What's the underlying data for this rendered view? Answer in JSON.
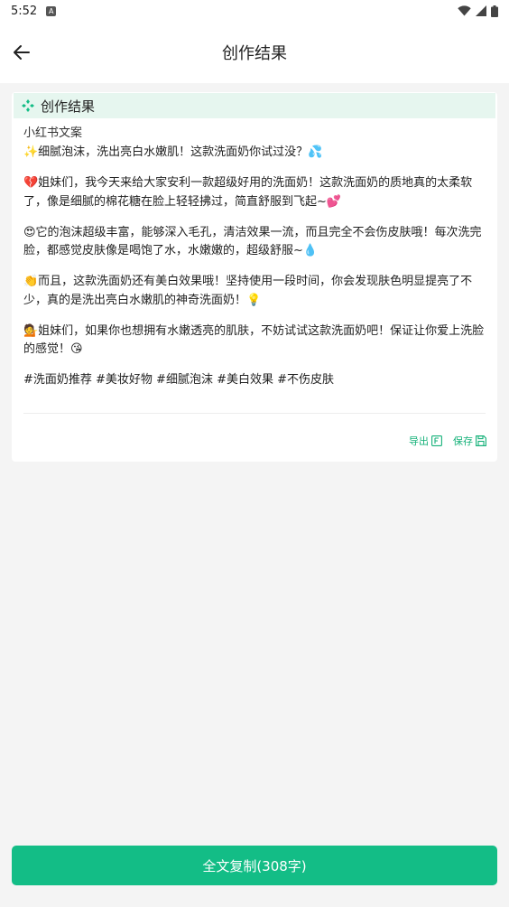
{
  "status_bar": {
    "time": "5:52",
    "notification_icon": "app-notification-icon",
    "icons": [
      "wifi-icon",
      "signal-icon",
      "battery-icon"
    ]
  },
  "app_bar": {
    "title": "创作结果",
    "back_icon": "back-arrow-icon"
  },
  "card": {
    "header_title": "创作结果",
    "header_icon": "sparkle-diamond-icon",
    "subtitle": "小红书文案",
    "paragraphs": [
      "✨细腻泡沫，洗出亮白水嫩肌！这款洗面奶你试过没？💦",
      "💔姐妹们，我今天来给大家安利一款超级好用的洗面奶！这款洗面奶的质地真的太柔软了，像是细腻的棉花糖在脸上轻轻拂过，简直舒服到飞起~💕",
      "😍它的泡沫超级丰富，能够深入毛孔，清洁效果一流，而且完全不会伤皮肤哦！每次洗完脸，都感觉皮肤像是喝饱了水，水嫩嫩的，超级舒服~💧",
      "👏而且，这款洗面奶还有美白效果哦！坚持使用一段时间，你会发现肤色明显提亮了不少，真的是洗出亮白水嫩肌的神奇洗面奶！💡",
      "💁姐妹们，如果你也想拥有水嫩透亮的肌肤，不妨试试这款洗面奶吧！保证让你爱上洗脸的感觉！😘"
    ],
    "tags": "#洗面奶推荐 #美妆好物 #细腻泡沫 #美白效果 #不伤皮肤",
    "actions": {
      "export_label": "导出",
      "export_icon": "export-icon",
      "save_label": "保存",
      "save_icon": "save-icon"
    }
  },
  "bottom": {
    "copy_button_label": "全文复制(308字)"
  },
  "colors": {
    "accent": "#13bd86",
    "header_bg": "#e6f6ef",
    "page_bg": "#f4f4f4"
  }
}
